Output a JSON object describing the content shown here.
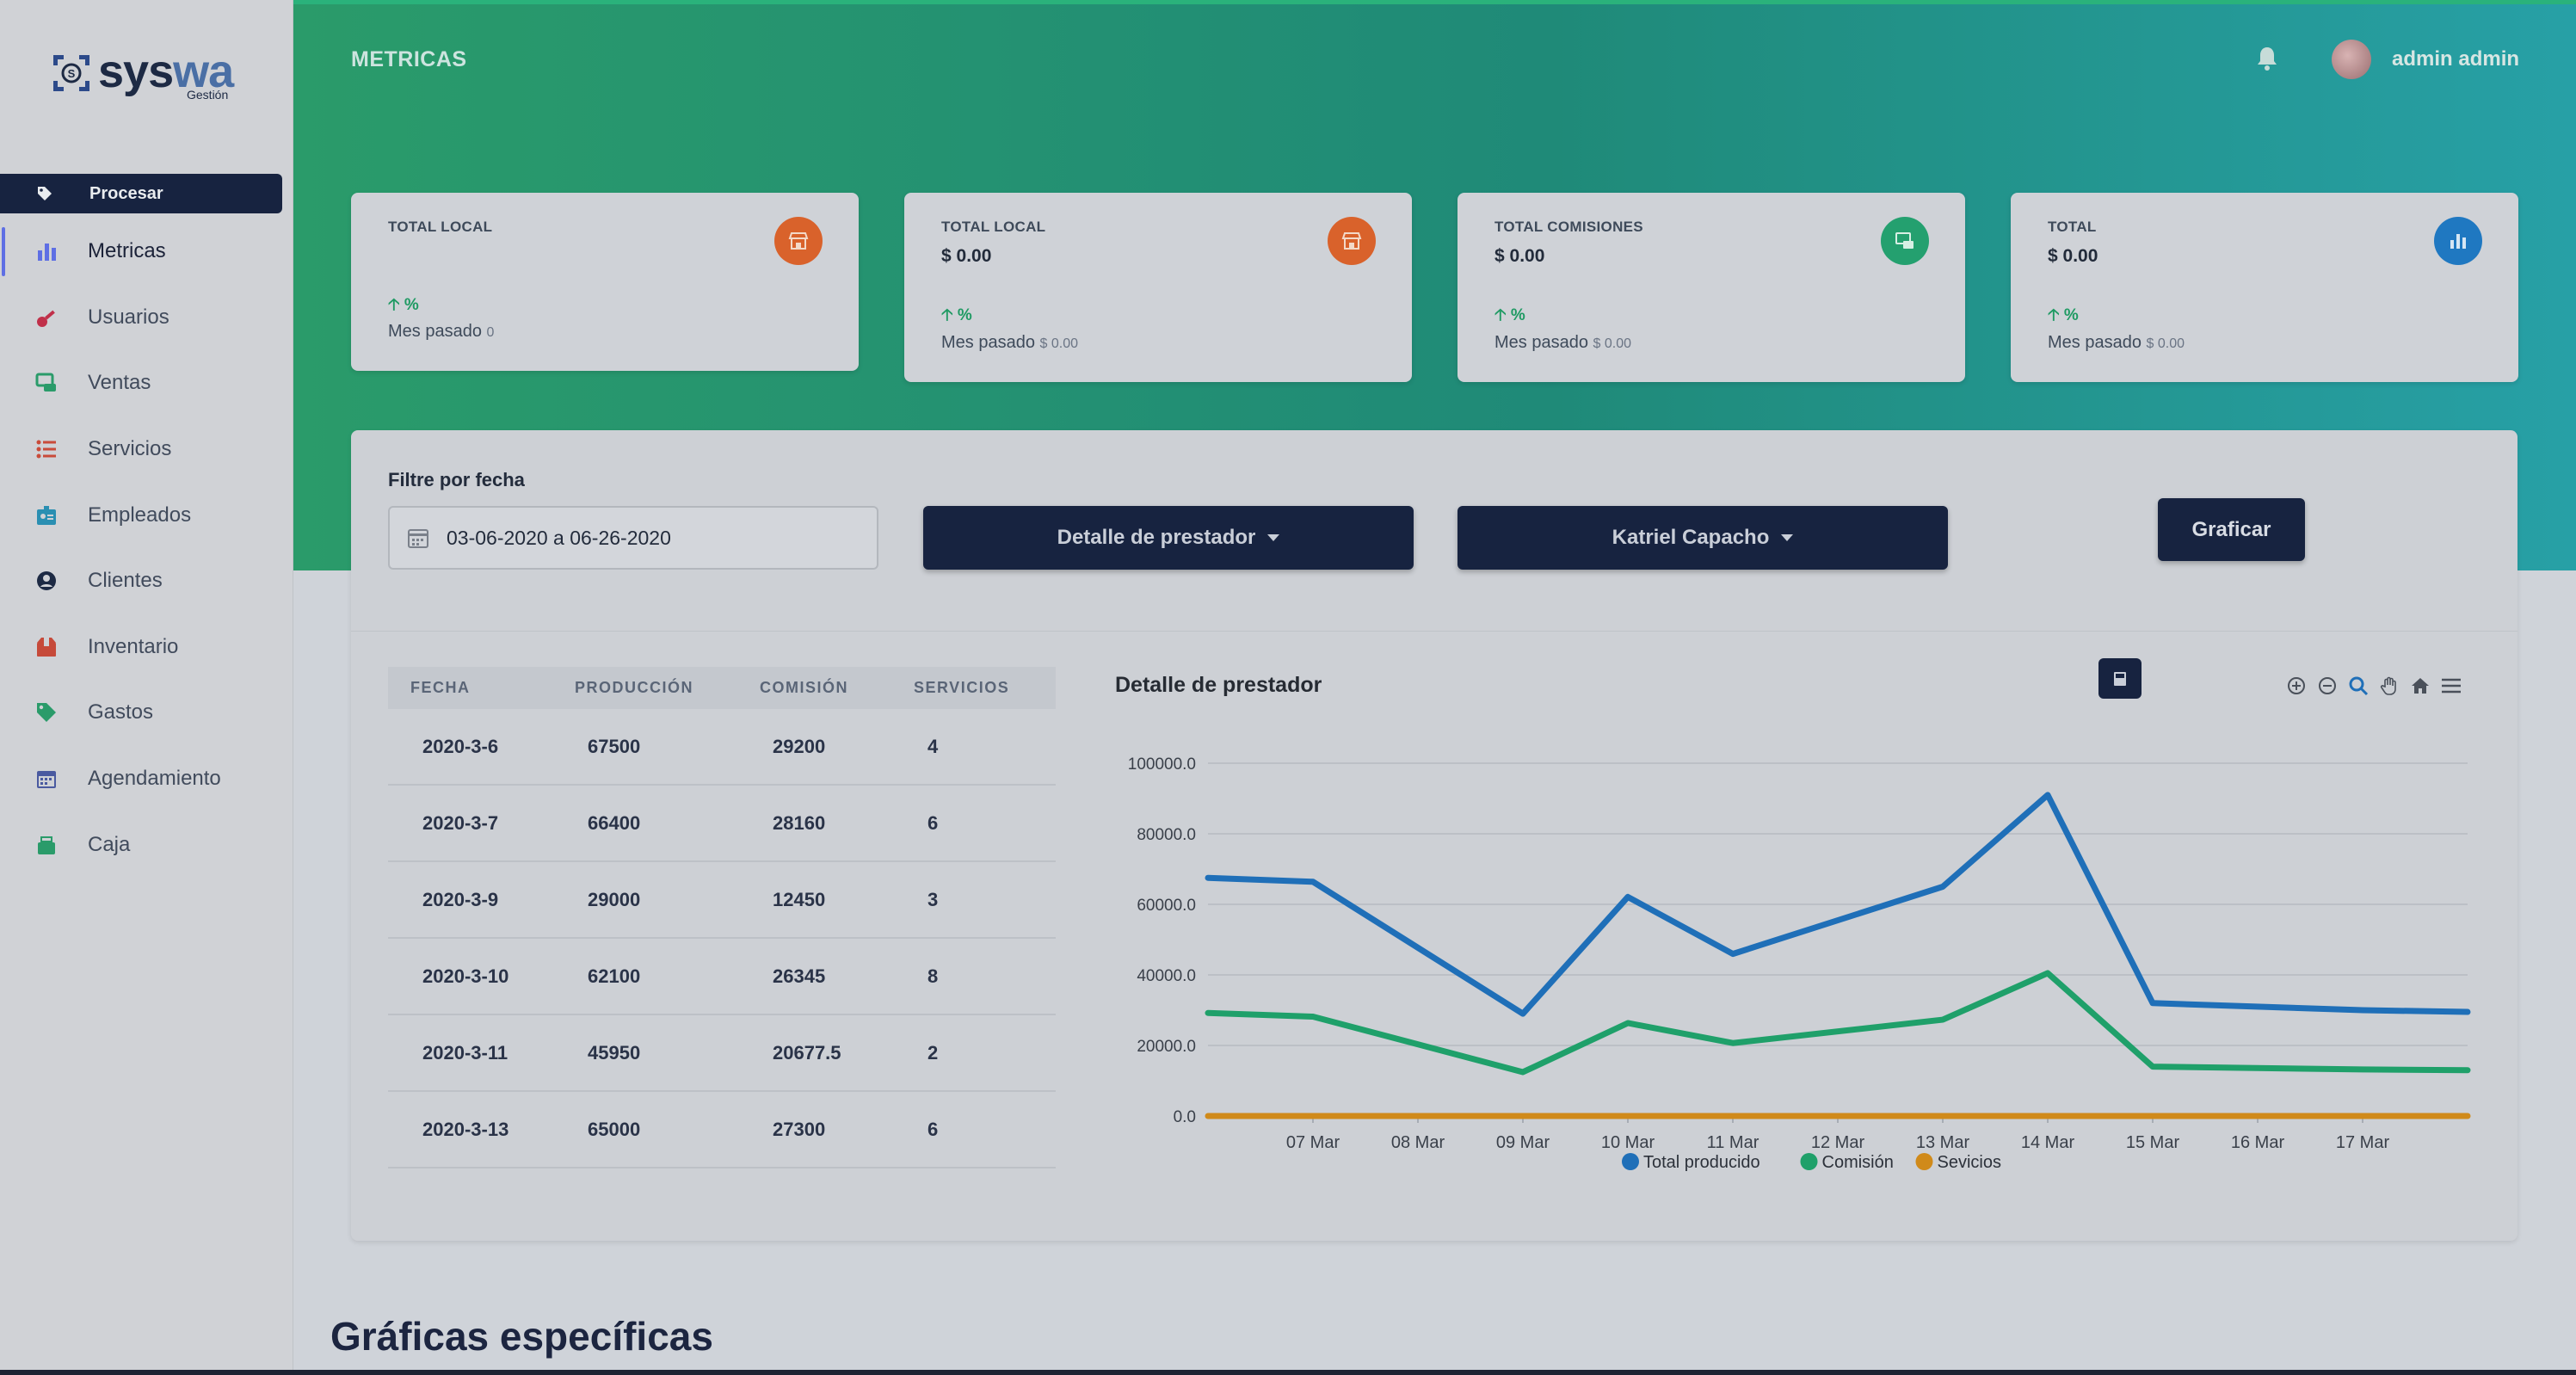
{
  "brand": {
    "name_a": "sys",
    "name_b": "wa",
    "subtitle": "Gestión"
  },
  "sidebar": {
    "process_label": "Procesar",
    "items": [
      {
        "label": "Metricas",
        "icon": "bar-chart-icon",
        "color": "#5e6fe4"
      },
      {
        "label": "Usuarios",
        "icon": "key-icon",
        "color": "#c0304a"
      },
      {
        "label": "Ventas",
        "icon": "ventas-icon",
        "color": "#2a9b6a"
      },
      {
        "label": "Servicios",
        "icon": "list-icon",
        "color": "#c94b3a"
      },
      {
        "label": "Empleados",
        "icon": "badge-icon",
        "color": "#2a8fb2"
      },
      {
        "label": "Clientes",
        "icon": "user-circle-icon",
        "color": "#1d2a44"
      },
      {
        "label": "Inventario",
        "icon": "box-icon",
        "color": "#c64a3a"
      },
      {
        "label": "Gastos",
        "icon": "tag-icon",
        "color": "#2a9b6a"
      },
      {
        "label": "Agendamiento",
        "icon": "calendar-icon",
        "color": "#4a5aa0"
      },
      {
        "label": "Caja",
        "icon": "cash-box-icon",
        "color": "#2a9b6a"
      }
    ]
  },
  "header": {
    "title": "METRICAS",
    "user": "admin admin"
  },
  "cards": [
    {
      "title": "TOTAL LOCAL",
      "value": "",
      "trend": "%",
      "foot_label": "Mes pasado",
      "foot_value": "0",
      "icon": "store-icon",
      "icon_color": "#d9622b"
    },
    {
      "title": "TOTAL LOCAL",
      "value": "$ 0.00",
      "trend": "%",
      "foot_label": "Mes pasado",
      "foot_value": "$ 0.00",
      "icon": "store-icon",
      "icon_color": "#d9622b"
    },
    {
      "title": "TOTAL COMISIONES",
      "value": "$ 0.00",
      "trend": "%",
      "foot_label": "Mes pasado",
      "foot_value": "$ 0.00",
      "icon": "money-icon",
      "icon_color": "#24a06f"
    },
    {
      "title": "TOTAL",
      "value": "$ 0.00",
      "trend": "%",
      "foot_label": "Mes pasado",
      "foot_value": "$ 0.00",
      "icon": "chart-icon",
      "icon_color": "#1f78c1"
    }
  ],
  "filter": {
    "label": "Filtre por fecha",
    "date_range": "03-06-2020 a 06-26-2020",
    "detail_dropdown": "Detalle de prestador",
    "employee_dropdown": "Katriel Capacho",
    "graph_button": "Graficar"
  },
  "table": {
    "headers": [
      "FECHA",
      "PRODUCCIÓN",
      "COMISIÓN",
      "SERVICIOS"
    ],
    "rows": [
      [
        "2020-3-6",
        "67500",
        "29200",
        "4"
      ],
      [
        "2020-3-7",
        "66400",
        "28160",
        "6"
      ],
      [
        "2020-3-9",
        "29000",
        "12450",
        "3"
      ],
      [
        "2020-3-10",
        "62100",
        "26345",
        "8"
      ],
      [
        "2020-3-11",
        "45950",
        "20677.5",
        "2"
      ],
      [
        "2020-3-13",
        "65000",
        "27300",
        "6"
      ]
    ]
  },
  "chart_data": {
    "type": "line",
    "title": "Detalle de prestador",
    "xlabel": "",
    "ylabel": "",
    "x_dates": [
      "2020-03-06",
      "2020-03-07",
      "2020-03-09",
      "2020-03-10",
      "2020-03-11",
      "2020-03-13",
      "2020-03-14",
      "2020-03-15",
      "2020-03-17",
      "2020-03-18"
    ],
    "x_ticks": [
      "07 Mar",
      "08 Mar",
      "09 Mar",
      "10 Mar",
      "11 Mar",
      "12 Mar",
      "13 Mar",
      "14 Mar",
      "15 Mar",
      "16 Mar",
      "17 Mar"
    ],
    "x_range": [
      "2020-03-06",
      "2020-03-18"
    ],
    "ylim": [
      0,
      100000
    ],
    "y_ticks": [
      "0.0",
      "20000.0",
      "40000.0",
      "60000.0",
      "80000.0",
      "100000.0"
    ],
    "grid": true,
    "legend_position": "bottom",
    "series": [
      {
        "name": "Total producido",
        "color": "#1f6fb8",
        "values": [
          67500,
          66400,
          29000,
          62100,
          45950,
          65000,
          91000,
          32000,
          30000,
          29500
        ]
      },
      {
        "name": "Comisión",
        "color": "#1fa06a",
        "values": [
          29200,
          28160,
          12450,
          26345,
          20677.5,
          27300,
          40500,
          14000,
          13200,
          13000
        ]
      },
      {
        "name": "Sevicios",
        "color": "#d08a1a",
        "values": [
          4,
          6,
          3,
          8,
          2,
          6,
          5,
          4,
          3,
          2
        ]
      }
    ]
  },
  "section": {
    "title": "Gráficas específicas"
  }
}
